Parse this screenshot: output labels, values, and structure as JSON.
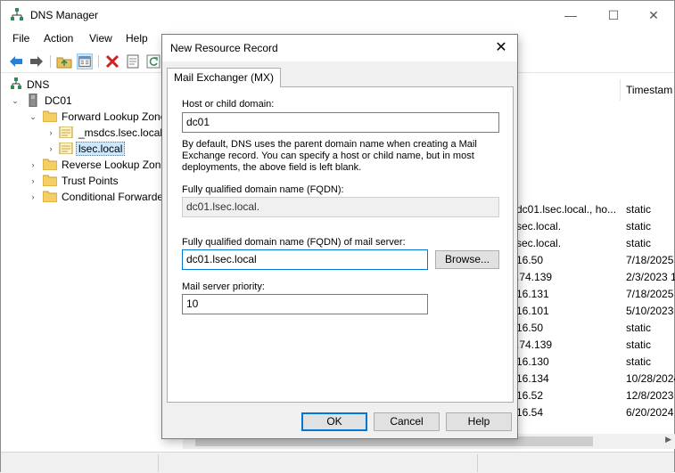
{
  "app": {
    "title": "DNS Manager",
    "window_controls": {
      "minimize": "—",
      "maximize": "☐",
      "close": "✕"
    }
  },
  "menu": [
    "File",
    "Action",
    "View",
    "Help"
  ],
  "toolbar": {
    "icons": [
      "back-arrow-icon",
      "forward-arrow-icon",
      "up-folder-icon",
      "show-hide-tree-icon",
      "delete-icon",
      "properties-icon",
      "refresh-icon"
    ]
  },
  "tree": {
    "root": "DNS",
    "server": "DC01",
    "forward_zones": "Forward Lookup Zone",
    "msdcs": "_msdcs.lsec.local",
    "lsec": "lsec.local",
    "reverse_zones": "Reverse Lookup Zone",
    "trust_points": "Trust Points",
    "conditional_forwarders": "Conditional Forwarde"
  },
  "records": {
    "column_timestamp": "Timestam",
    "rows": [
      {
        "data": "dc01.lsec.local., ho...",
        "timestamp": "static"
      },
      {
        "data": "sec.local.",
        "timestamp": "static"
      },
      {
        "data": "sec.local.",
        "timestamp": "static"
      },
      {
        "data": "16.50",
        "timestamp": "7/18/2025"
      },
      {
        "data": ".74.139",
        "timestamp": "2/3/2023 1"
      },
      {
        "data": "16.131",
        "timestamp": "7/18/2025"
      },
      {
        "data": "16.101",
        "timestamp": "5/10/2023"
      },
      {
        "data": "16.50",
        "timestamp": "static"
      },
      {
        "data": ".74.139",
        "timestamp": "static"
      },
      {
        "data": "16.130",
        "timestamp": "static"
      },
      {
        "data": "16.134",
        "timestamp": "10/28/2024"
      },
      {
        "data": "16.52",
        "timestamp": "12/8/2023"
      },
      {
        "data": "16.54",
        "timestamp": "6/20/2024"
      }
    ]
  },
  "dialog": {
    "title": "New Resource Record",
    "close": "✕",
    "tab": "Mail Exchanger (MX)",
    "host_label": "Host or child domain:",
    "host_value": "dc01",
    "description": "By default, DNS uses the parent domain name when creating a Mail Exchange record. You can specify a host or child name, but in most deployments, the above field is left blank.",
    "fqdn_label": "Fully qualified domain name (FQDN):",
    "fqdn_value": "dc01.lsec.local.",
    "mail_fqdn_label": "Fully qualified domain name (FQDN) of mail server:",
    "mail_fqdn_value": "dc01.lsec.local",
    "browse_label": "Browse...",
    "priority_label": "Mail server priority:",
    "priority_value": "10",
    "ok_label": "OK",
    "cancel_label": "Cancel",
    "help_label": "Help"
  }
}
